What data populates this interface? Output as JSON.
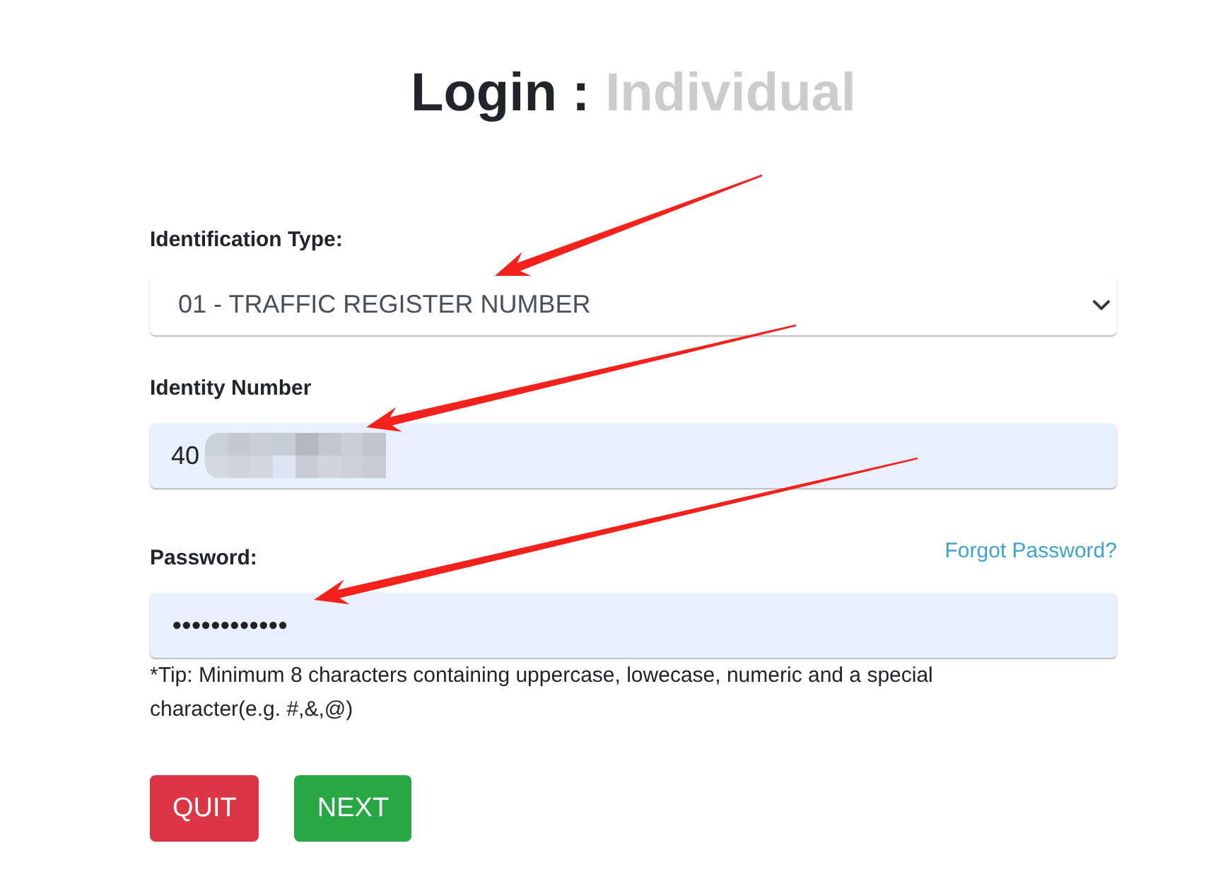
{
  "title": {
    "heading": "Login :",
    "account_type": "Individual"
  },
  "fields": [
    {
      "kind": "select",
      "label": "Identification Type:",
      "value": "01 - TRAFFIC REGISTER NUMBER"
    },
    {
      "kind": "text",
      "label": "Identity Number",
      "value": "40",
      "redacted": true
    },
    {
      "kind": "password",
      "label": "Password:",
      "link": "Forgot Password?",
      "value": "••••••••••••",
      "tip": "*Tip: Minimum 8 characters containing uppercase, lowecase, numeric and a special character(e.g. #,&,@)"
    }
  ],
  "buttons": [
    {
      "kind": "danger",
      "label": "QUIT"
    },
    {
      "kind": "success",
      "label": "NEXT"
    }
  ]
}
